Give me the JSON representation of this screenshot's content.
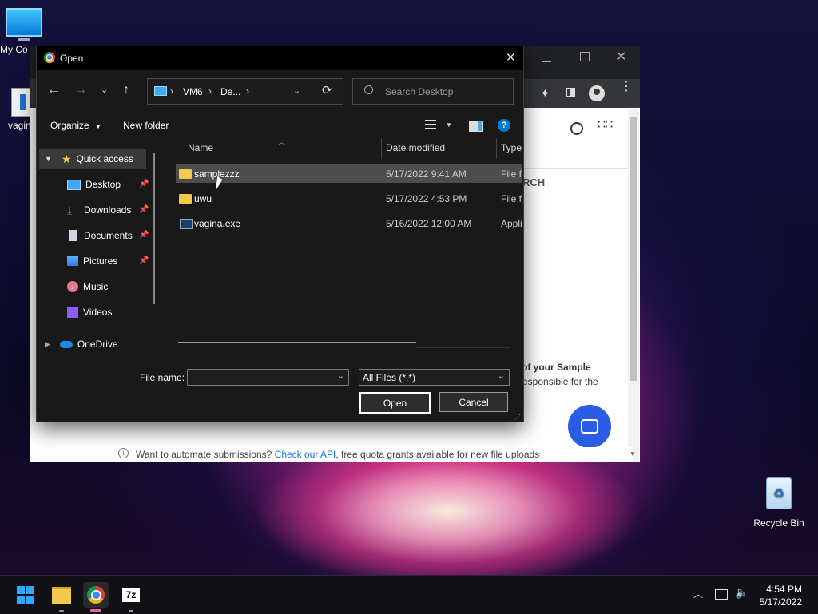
{
  "desktop": {
    "icons": [
      {
        "label": "My Co"
      },
      {
        "label": "vagin"
      },
      {
        "label": "Recycle Bin"
      }
    ]
  },
  "browser": {
    "partial_heading": "RCH",
    "partial_line1": "of your Sample",
    "partial_line2": "esponsible for the",
    "footer_prefix": "Want to automate submissions?",
    "footer_link": "Check our API",
    "footer_suffix": ", free quota grants available for new file uploads"
  },
  "dialog": {
    "title": "Open",
    "address": {
      "seg1": "VM6",
      "seg2": "De..."
    },
    "search_placeholder": "Search Desktop",
    "organize_label": "Organize",
    "new_folder_label": "New folder",
    "nav": {
      "quick_access": "Quick access",
      "desktop": "Desktop",
      "downloads": "Downloads",
      "documents": "Documents",
      "pictures": "Pictures",
      "music": "Music",
      "videos": "Videos",
      "onedrive": "OneDrive"
    },
    "columns": {
      "name": "Name",
      "date": "Date modified",
      "type": "Type"
    },
    "files": [
      {
        "name": "samplezzz",
        "date": "5/17/2022 9:41 AM",
        "type": "File fo",
        "kind": "folder-icon"
      },
      {
        "name": "uwu",
        "date": "5/17/2022 4:53 PM",
        "type": "File fo",
        "kind": "folder-icon"
      },
      {
        "name": "vagina.exe",
        "date": "5/16/2022 12:00 AM",
        "type": "Appli",
        "kind": "exe-icon"
      }
    ],
    "file_name_label": "File name:",
    "file_name_value": "",
    "filter_value": "All Files (*.*)",
    "open_label": "Open",
    "cancel_label": "Cancel"
  },
  "taskbar": {
    "time": "4:54 PM",
    "date": "5/17/2022"
  },
  "colors": {
    "accent": "#0078d4",
    "selection": "#4d4d4d",
    "link": "#1a73e8",
    "chat_button": "#2b5ce6"
  }
}
